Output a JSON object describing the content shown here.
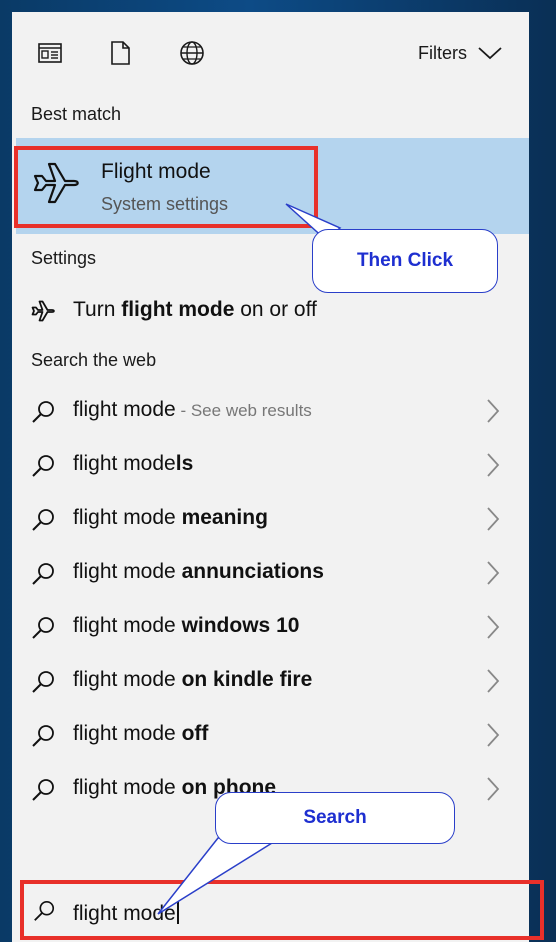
{
  "toolbar": {
    "icons": [
      "apps-icon",
      "documents-icon",
      "web-icon"
    ],
    "filters_label": "Filters"
  },
  "best_match": {
    "heading": "Best match",
    "title": "Flight mode",
    "subtitle": "System settings"
  },
  "settings": {
    "heading": "Settings",
    "item": {
      "prefix": "Turn ",
      "bold": "flight mode",
      "suffix": " on or off"
    }
  },
  "web": {
    "heading": "Search the web",
    "first": {
      "text": "flight mode",
      "sub": " - See web results"
    },
    "items": [
      {
        "prefix": "flight mode",
        "bold": "ls"
      },
      {
        "prefix": "flight mode ",
        "bold": "meaning"
      },
      {
        "prefix": "flight mode ",
        "bold": "annunciations"
      },
      {
        "prefix": "flight mode ",
        "bold": "windows 10"
      },
      {
        "prefix": "flight mode ",
        "bold": "on kindle fire"
      },
      {
        "prefix": "flight mode ",
        "bold": "off"
      },
      {
        "prefix": "flight mode ",
        "bold": "on phone"
      }
    ]
  },
  "search": {
    "value": "flight mode"
  },
  "callouts": {
    "click": "Then Click",
    "search": "Search"
  },
  "colors": {
    "highlight": "#b4d4ee",
    "annotation_red": "#e8302a",
    "callout_blue": "#1e2fd0"
  }
}
